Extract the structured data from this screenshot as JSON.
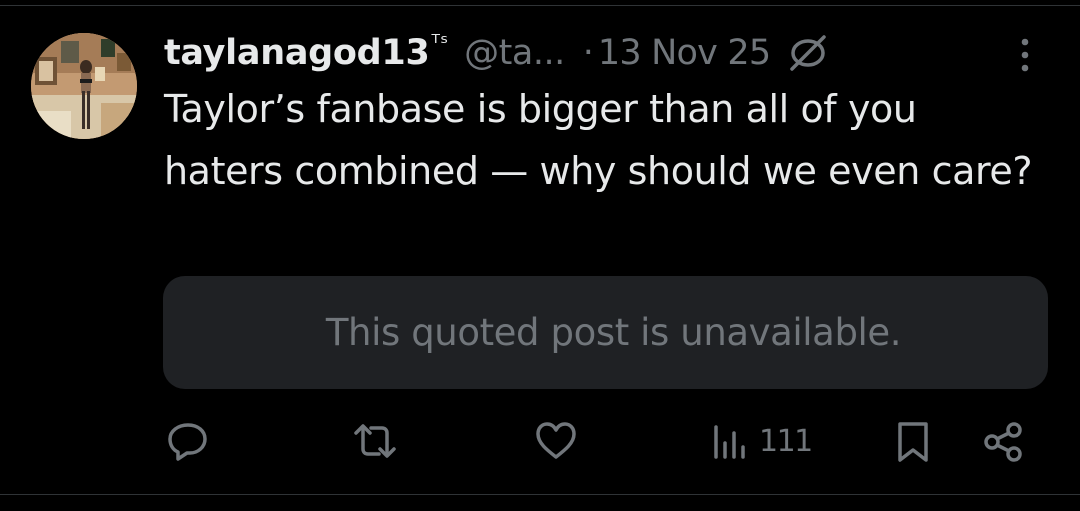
{
  "tweet": {
    "display_name": "taylanagod13",
    "name_badge": "ᵀˢ",
    "handle": "@ta...",
    "separator": "·",
    "date": "13 Nov 25",
    "text": "Taylor’s fanbase is bigger than all of you haters combined — why should we even care?",
    "quoted_post_notice": "This quoted post is unavailable."
  },
  "actions": {
    "reply_icon": "reply-icon",
    "retweet_icon": "retweet-icon",
    "like_icon": "like-icon",
    "views_icon": "views-icon",
    "views_count": "111",
    "bookmark_icon": "bookmark-icon",
    "share_icon": "share-icon"
  },
  "colors": {
    "background": "#000000",
    "primary_text": "#e7e9ea",
    "secondary_text": "#71767b",
    "quote_background": "#1f2124"
  }
}
